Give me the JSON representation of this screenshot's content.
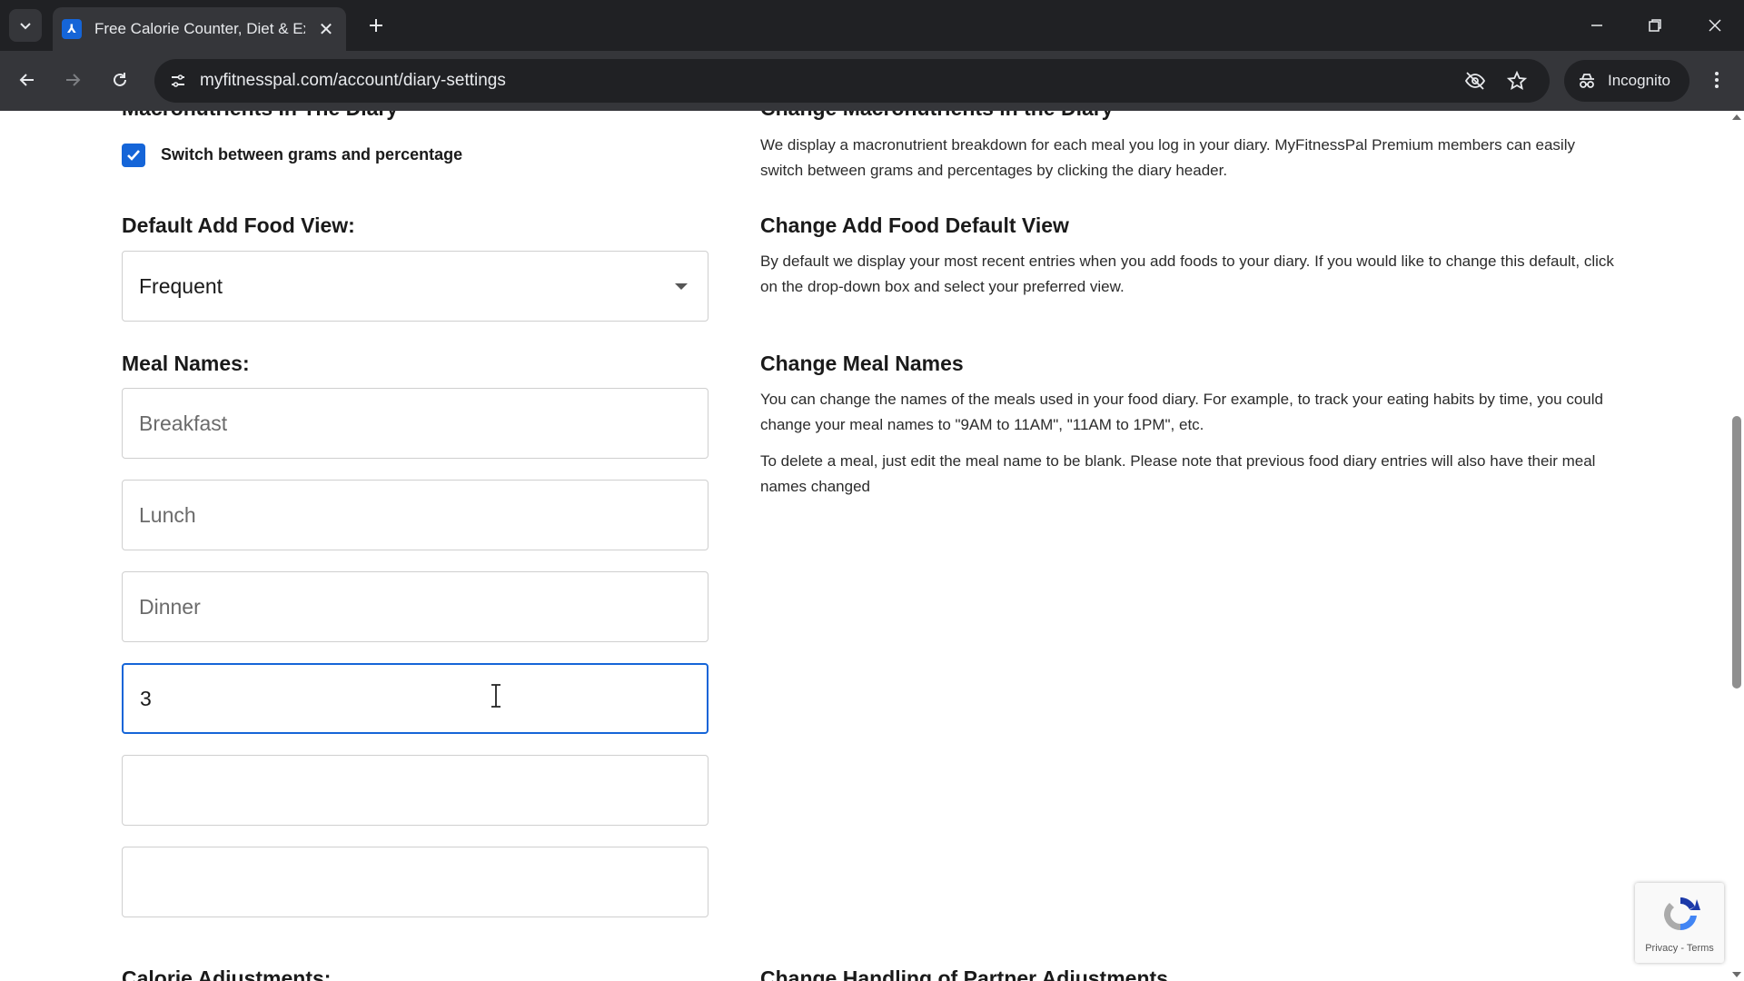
{
  "browser": {
    "tab_title": "Free Calorie Counter, Diet & Exercise",
    "url": "myfitnesspal.com/account/diary-settings",
    "incognito_label": "Incognito"
  },
  "left": {
    "macros_heading": "Macronutrients In The Diary",
    "macros_checkbox_label": "Switch between grams and percentage",
    "macros_checked": true,
    "default_view_label": "Default Add Food View:",
    "default_view_value": "Frequent",
    "meal_names_label": "Meal Names:",
    "meal_fields": [
      {
        "value": "",
        "placeholder": "Breakfast"
      },
      {
        "value": "",
        "placeholder": "Lunch"
      },
      {
        "value": "",
        "placeholder": "Dinner"
      },
      {
        "value": "3",
        "placeholder": ""
      },
      {
        "value": "",
        "placeholder": ""
      },
      {
        "value": "",
        "placeholder": ""
      }
    ],
    "calorie_heading": "Calorie Adjustments:"
  },
  "right": {
    "macros_heading": "Change Macronutrients in the Diary",
    "macros_text": "We display a macronutrient breakdown for each meal you log in your diary. MyFitnessPal Premium members can easily switch between grams and percentages by clicking the diary header.",
    "default_view_heading": "Change Add Food Default View",
    "default_view_text": "By default we display your most recent entries when you add foods to your diary. If you would like to change this default, click on the drop-down box and select your preferred view.",
    "meal_names_heading": "Change Meal Names",
    "meal_names_text_1": "You can change the names of the meals used in your food diary. For example, to track your eating habits by time, you could change your meal names to \"9AM to 11AM\", \"11AM to 1PM\", etc.",
    "meal_names_text_2": "To delete a meal, just edit the meal name to be blank. Please note that previous food diary entries will also have their meal names changed",
    "partner_heading": "Change Handling of Partner Adjustments"
  },
  "recaptcha": {
    "links": "Privacy - Terms"
  },
  "colors": {
    "accent": "#1565d8",
    "chrome_dark": "#202124",
    "chrome_mid": "#35363a"
  }
}
